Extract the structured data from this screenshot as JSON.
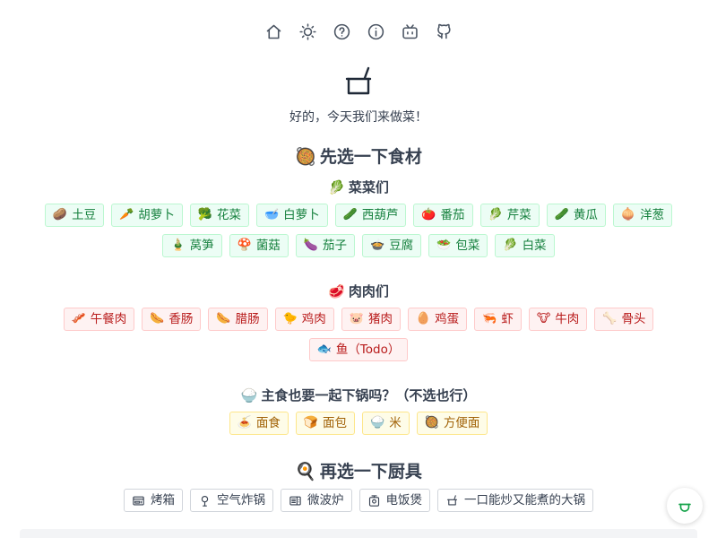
{
  "nav": {
    "icons": [
      "home-icon",
      "sun-icon",
      "help-icon",
      "info-icon",
      "bilibili-icon",
      "github-icon"
    ]
  },
  "hero": {
    "icon": "pot-icon",
    "tagline": "好的，今天我们来做菜！"
  },
  "ingredients": {
    "title": "先选一下食材",
    "title_emoji": "🥘",
    "vegetables": {
      "title": "菜菜们",
      "emoji": "🥬",
      "items": [
        {
          "emoji": "🥔",
          "label": "土豆"
        },
        {
          "emoji": "🥕",
          "label": "胡萝卜"
        },
        {
          "emoji": "🥦",
          "label": "花菜"
        },
        {
          "emoji": "🥣",
          "label": "白萝卜"
        },
        {
          "emoji": "🥒",
          "label": "西葫芦"
        },
        {
          "emoji": "🍅",
          "label": "番茄"
        },
        {
          "emoji": "🥬",
          "label": "芹菜"
        },
        {
          "emoji": "🥒",
          "label": "黄瓜"
        },
        {
          "emoji": "🧅",
          "label": "洋葱"
        },
        {
          "emoji": "🎍",
          "label": "莴笋"
        },
        {
          "emoji": "🍄",
          "label": "菌菇"
        },
        {
          "emoji": "🍆",
          "label": "茄子"
        },
        {
          "emoji": "🍲",
          "label": "豆腐"
        },
        {
          "emoji": "🥗",
          "label": "包菜"
        },
        {
          "emoji": "🥬",
          "label": "白菜"
        }
      ]
    },
    "meats": {
      "title": "肉肉们",
      "emoji": "🥩",
      "items": [
        {
          "emoji": "🥓",
          "label": "午餐肉"
        },
        {
          "emoji": "🌭",
          "label": "香肠"
        },
        {
          "emoji": "🌭",
          "label": "腊肠"
        },
        {
          "emoji": "🐤",
          "label": "鸡肉"
        },
        {
          "emoji": "🐷",
          "label": "猪肉"
        },
        {
          "emoji": "🥚",
          "label": "鸡蛋"
        },
        {
          "emoji": "🦐",
          "label": "虾"
        },
        {
          "emoji": "🐮",
          "label": "牛肉"
        },
        {
          "emoji": "🦴",
          "label": "骨头"
        },
        {
          "emoji": "🐟",
          "label": "鱼（Todo）"
        }
      ]
    },
    "staples": {
      "title": "主食也要一起下锅吗？（不选也行）",
      "emoji": "🍚",
      "items": [
        {
          "emoji": "🍝",
          "label": "面食"
        },
        {
          "emoji": "🍞",
          "label": "面包"
        },
        {
          "emoji": "🍚",
          "label": "米"
        },
        {
          "emoji": "🥘",
          "label": "方便面"
        }
      ]
    }
  },
  "tools": {
    "title": "再选一下厨具",
    "title_emoji": "🍳",
    "items": [
      {
        "icon": "oven-icon",
        "label": "烤箱"
      },
      {
        "icon": "air-fryer-icon",
        "label": "空气炸锅"
      },
      {
        "icon": "microwave-icon",
        "label": "微波炉"
      },
      {
        "icon": "rice-cooker-icon",
        "label": "电饭煲"
      },
      {
        "icon": "big-pot-icon",
        "label": "一口能炒又能煮的大锅"
      }
    ]
  },
  "float_button": {
    "icon": "pot-icon"
  },
  "colors": {
    "veg_bg": "#ecfdf5",
    "veg_text": "#15803d",
    "meat_bg": "#fef2f2",
    "meat_text": "#b91c1c",
    "staple_bg": "#fefce8",
    "staple_text": "#a16207",
    "accent": "#16a34a"
  }
}
